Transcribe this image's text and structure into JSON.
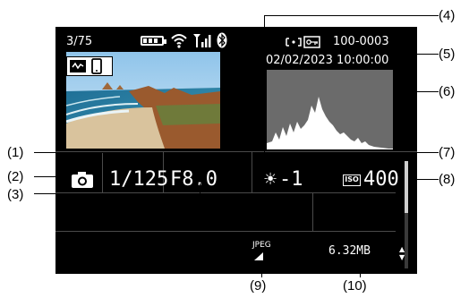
{
  "status": {
    "image_counter": "3/75",
    "folder_file": "100-0003",
    "date_time": "02/02/2023 10:00:00"
  },
  "exposure": {
    "shutter_speed": "1/125",
    "aperture": "F8.0",
    "exposure_comp": "-1",
    "iso_label": "ISO",
    "iso_value": "400"
  },
  "file": {
    "format": "JPEG",
    "size": "6.32MB"
  },
  "callouts": [
    "(1)",
    "(2)",
    "(3)",
    "(4)",
    "(5)",
    "(6)",
    "(7)",
    "(8)",
    "(9)",
    "(10)"
  ],
  "colors": {
    "screen_bg": "#000000",
    "histogram_bg": "#6b6b6b",
    "histogram_fill": "#ffffff",
    "grid_line": "#4a4a4a"
  },
  "icons": [
    "battery-icon",
    "wifi-icon",
    "signal-icon",
    "bluetooth-icon",
    "protect-icon",
    "camera-icon",
    "sun-icon",
    "jpeg-quality-icon",
    "scroll-arrows-icon",
    "rating-icon",
    "smartphone-icon"
  ]
}
